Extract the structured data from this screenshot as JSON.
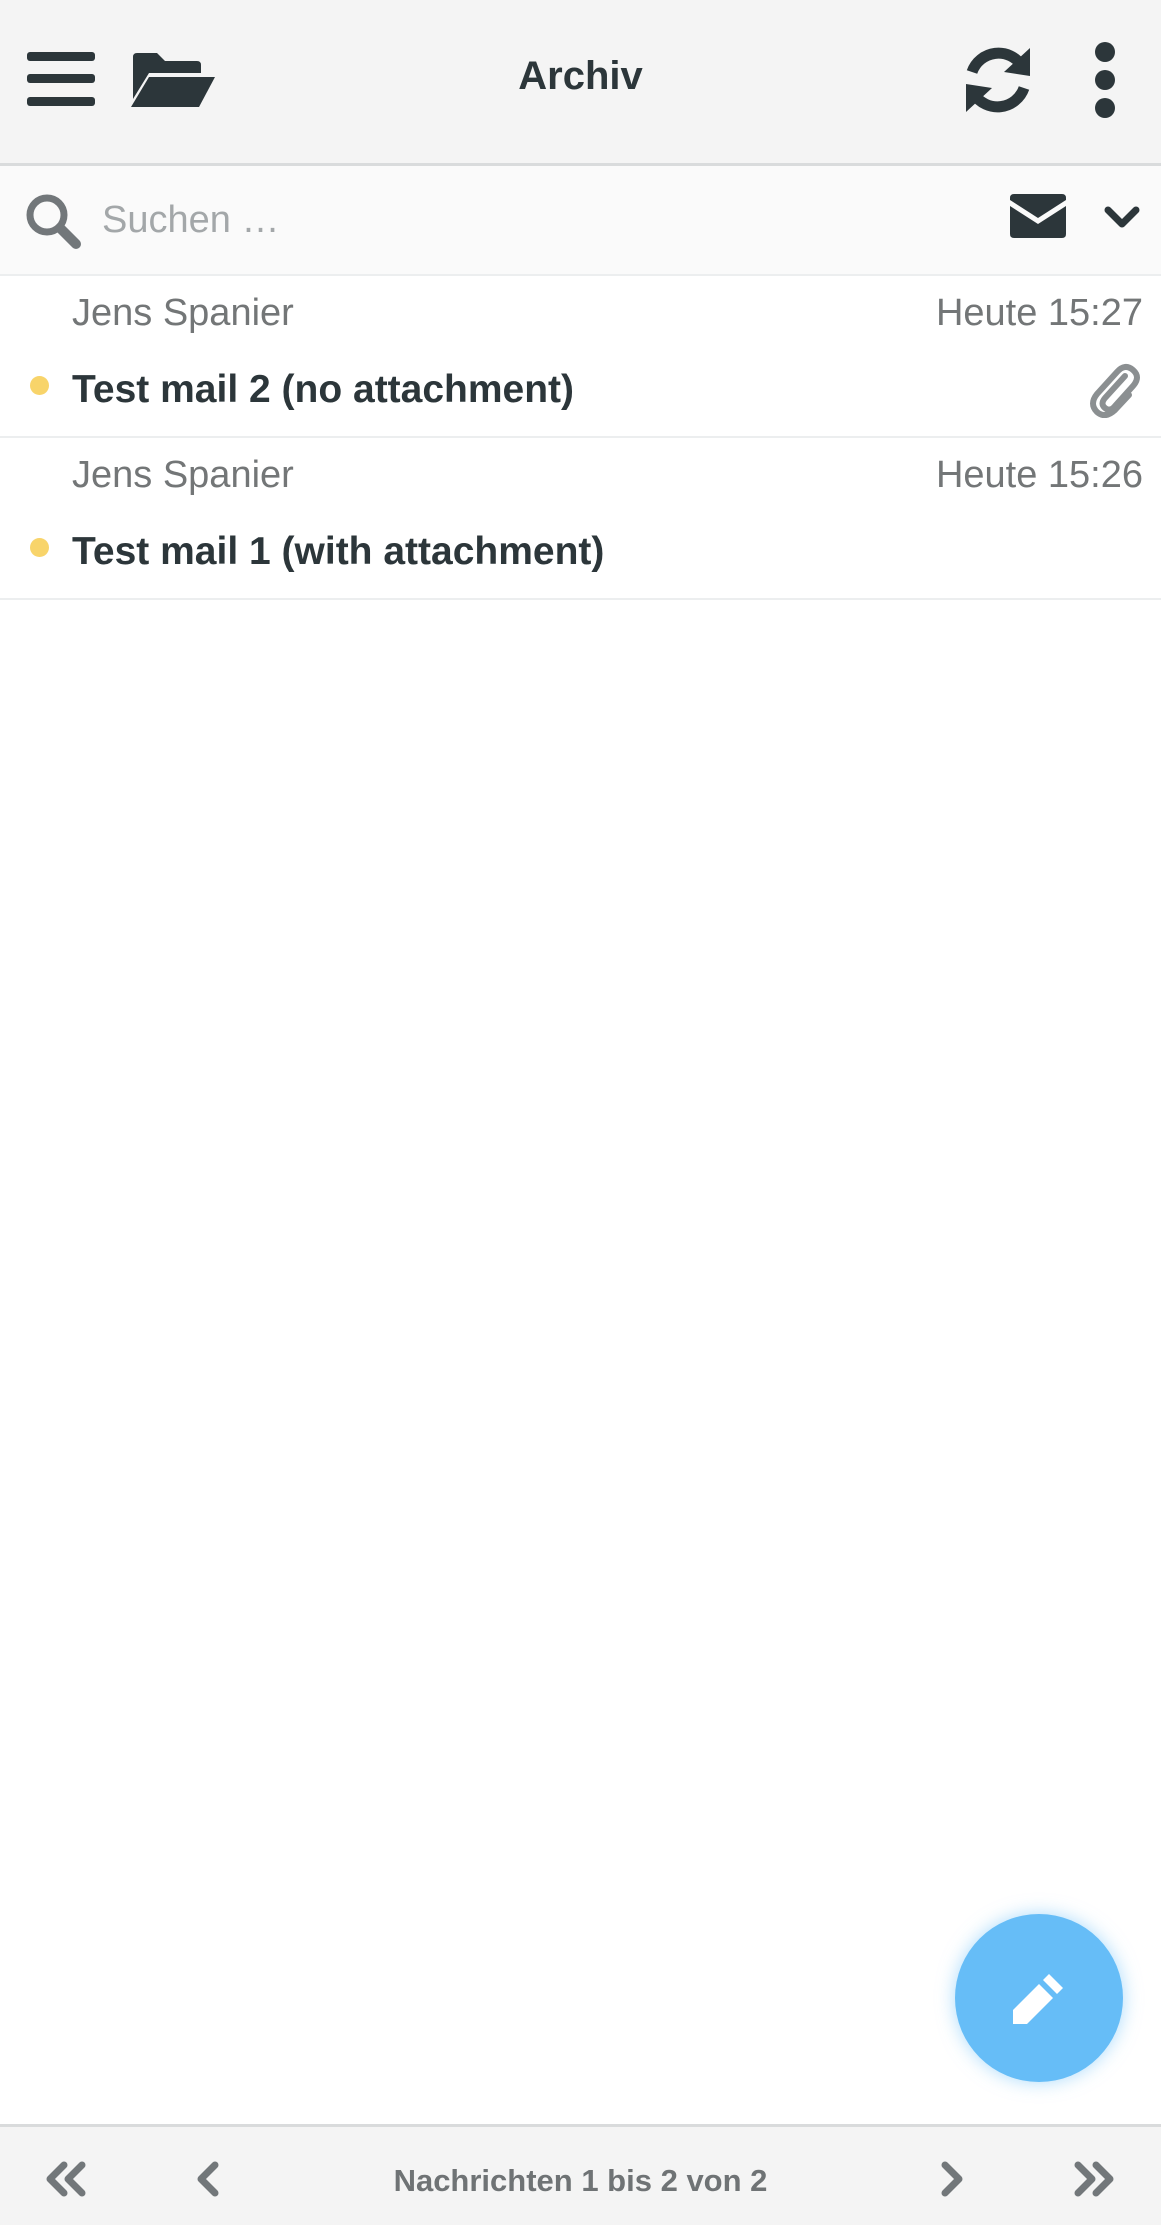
{
  "header": {
    "title": "Archiv",
    "menu_icon": "hamburger-icon",
    "folders_icon": "folder-open-icon",
    "refresh_icon": "refresh-icon",
    "more_icon": "vertical-dots-icon"
  },
  "search": {
    "placeholder": "Suchen …",
    "value": "",
    "search_icon": "search-icon",
    "filter_icon": "envelope-icon",
    "options_icon": "chevron-down-icon"
  },
  "messages": [
    {
      "from": "Jens Spanier",
      "date": "Heute 15:27",
      "subject": "Test mail 2 (no attachment)",
      "unread": true,
      "has_attachment": true
    },
    {
      "from": "Jens Spanier",
      "date": "Heute 15:26",
      "subject": "Test mail 1 (with attachment)",
      "unread": true,
      "has_attachment": false
    }
  ],
  "compose": {
    "icon": "pencil-icon"
  },
  "pagination": {
    "label": "Nachrichten 1 bis 2 von 2",
    "first_icon": "double-chevron-left-icon",
    "prev_icon": "chevron-left-icon",
    "next_icon": "chevron-right-icon",
    "last_icon": "double-chevron-right-icon"
  },
  "colors": {
    "accent": "#66bdf7",
    "unread_dot": "#f8d46a",
    "text": "#2c363a",
    "muted": "#737677"
  }
}
